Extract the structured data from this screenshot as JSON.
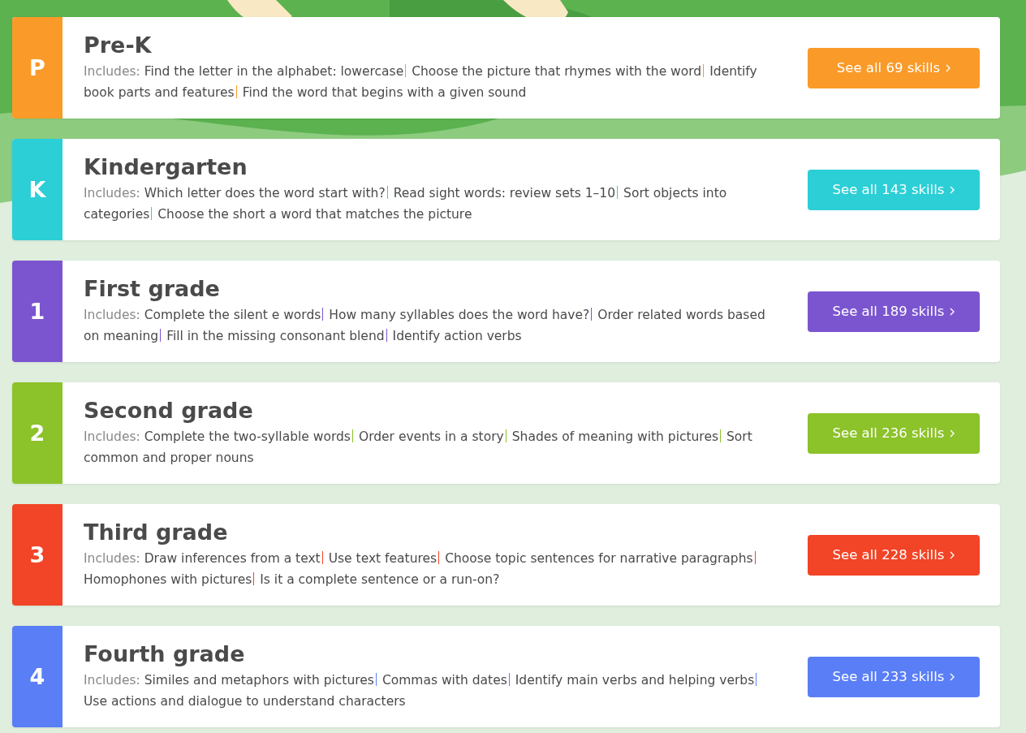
{
  "grades": [
    {
      "badge": "P",
      "title": "Pre-K",
      "color": "#fa9a28",
      "includes_label": "Includes:",
      "skills": [
        "Find the letter in the alphabet: lowercase",
        "Choose the picture that rhymes with the word",
        "Identify book parts and features",
        "Find the word that begins with a given sound"
      ],
      "button": "See all 69 skills"
    },
    {
      "badge": "K",
      "title": "Kindergarten",
      "color": "#2ccfd6",
      "includes_label": "Includes:",
      "skills": [
        "Which letter does the word start with?",
        "Read sight words: review sets 1–10",
        "Sort objects into categories",
        "Choose the short a word that matches the picture"
      ],
      "button": "See all 143 skills"
    },
    {
      "badge": "1",
      "title": "First grade",
      "color": "#7b55cf",
      "includes_label": "Includes:",
      "skills": [
        "Complete the silent e words",
        "How many syllables does the word have?",
        "Order related words based on meaning",
        "Fill in the missing consonant blend",
        "Identify action verbs"
      ],
      "button": "See all 189 skills"
    },
    {
      "badge": "2",
      "title": "Second grade",
      "color": "#8cc22a",
      "includes_label": "Includes:",
      "skills": [
        "Complete the two-syllable words",
        "Order events in a story",
        "Shades of meaning with pictures",
        "Sort common and proper nouns"
      ],
      "button": "See all 236 skills"
    },
    {
      "badge": "3",
      "title": "Third grade",
      "color": "#f24426",
      "includes_label": "Includes:",
      "skills": [
        "Draw inferences from a text",
        "Use text features",
        "Choose topic sentences for narrative paragraphs",
        "Homophones with pictures",
        "Is it a complete sentence or a run-on?"
      ],
      "button": "See all 228 skills"
    },
    {
      "badge": "4",
      "title": "Fourth grade",
      "color": "#5a7ef6",
      "includes_label": "Includes:",
      "skills": [
        "Similes and metaphors with pictures",
        "Commas with dates",
        "Identify main verbs and helping verbs",
        "Use actions and dialogue to understand characters"
      ],
      "button": "See all 233 skills"
    }
  ]
}
